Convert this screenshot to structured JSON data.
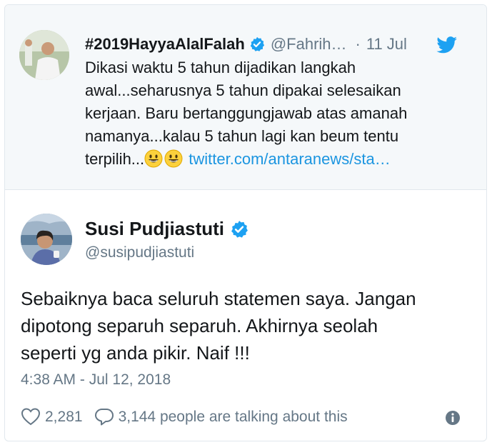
{
  "parent_tweet": {
    "display_name": "#2019HayyaAlalFalah",
    "handle": "@Fahrih…",
    "separator": "·",
    "date": "11 Jul",
    "text_line1": "Dikasi waktu 5 tahun dijadikan langkah",
    "text_line2": "awal...seharusnya 5 tahun dipakai selesaikan",
    "text_line3": "kerjaan. Baru bertanggungjawab atas amanah",
    "text_line4": "namanya...kalau 5 tahun lagi kan beum tentu",
    "text_line5_prefix": "terpilih...",
    "emojis": [
      "grinning-face",
      "grinning-face"
    ],
    "link_text": "twitter.com/antaranews/sta…"
  },
  "tweet": {
    "display_name": "Susi Pudjiastuti",
    "handle": "@susipudjiastuti",
    "text_line1": "Sebaiknya baca seluruh statemen saya. Jangan",
    "text_line2": "dipotong separuh separuh. Akhirnya seolah",
    "text_line3": "seperti yg anda pikir. Naif !!!",
    "timestamp": "4:38 AM - Jul 12, 2018"
  },
  "actions": {
    "like_count": "2,281",
    "reply_text": "3,144 people are talking about this"
  },
  "icons": {
    "verified": "verified-badge-icon",
    "bird": "twitter-bird-icon",
    "heart": "heart-icon",
    "reply": "speech-bubble-icon",
    "info": "info-icon"
  },
  "colors": {
    "brand": "#1da1f2",
    "link": "#1b95e0",
    "muted": "#657786",
    "text": "#14171a",
    "parent_bg": "#f5f8fa"
  }
}
